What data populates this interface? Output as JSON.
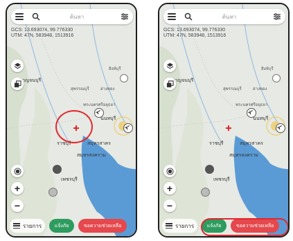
{
  "screens": [
    {
      "search_placeholder": "ค้นหา",
      "coords_gcs": "GCS: 13.693074, 99.776330",
      "coords_utm": "UTM: 47N, 583948, 1513916",
      "list_label": "รายการ",
      "report_label": "แจ้งภัย",
      "help_label": "ขอความช่วยเหลือ",
      "highlight": "map-crosshair"
    },
    {
      "search_placeholder": "ค้นหา",
      "coords_gcs": "GCS: 13.693074, 99.776330",
      "coords_utm": "UTM: 47N, 583948, 1513916",
      "list_label": "รายการ",
      "report_label": "แจ้งภัย",
      "help_label": "ขอความช่วยเหลือ",
      "highlight": "report-and-help-buttons"
    }
  ],
  "map_labels": [
    "สิงห์บุรี",
    "สุพรรณบุรี",
    "อ่างทอง",
    "พระนครศรีอยุธยา",
    "นนทบุรี",
    "ปทุมธานี",
    "ราชบุรี",
    "สมุทรสาคร",
    "สมุทรสงคราม",
    "เพชรบุรี",
    "กาญจนบุรี"
  ],
  "colors": {
    "map_land": "#e6e9e4",
    "map_sea": "#5b9bd5",
    "report_button": "#2e9b5f",
    "help_button": "#e5484d",
    "highlight_ring": "#e3262b",
    "crosshair": "#e3262b"
  },
  "icons": [
    "menu-icon",
    "search-icon",
    "filter-icon",
    "layers-icon",
    "stack-icon",
    "location-icon",
    "zoom-in-icon",
    "zoom-out-icon",
    "list-icon",
    "airport-icon",
    "storm-icon"
  ]
}
